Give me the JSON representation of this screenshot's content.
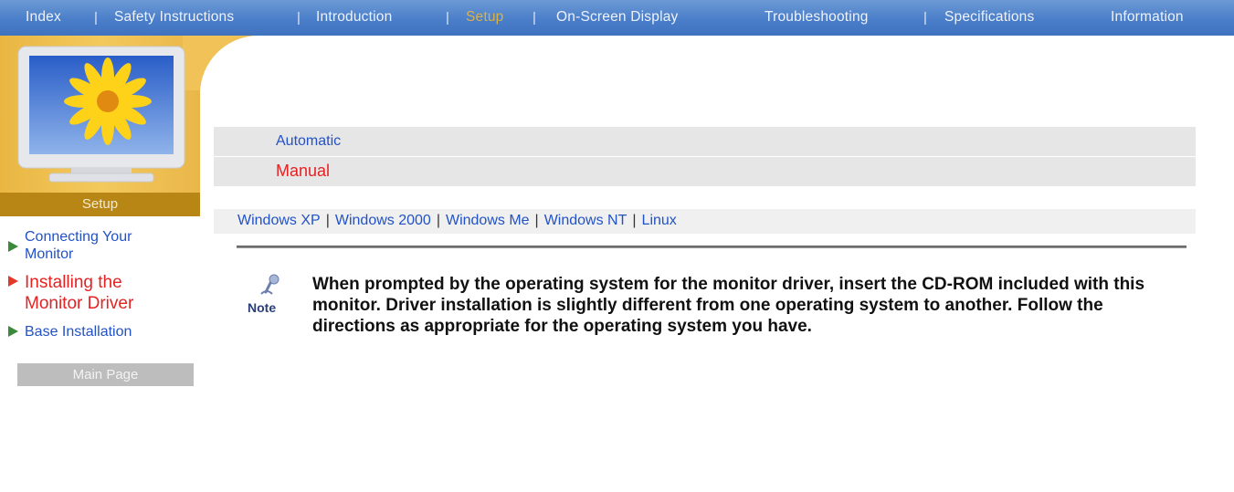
{
  "topnav": {
    "items": [
      {
        "label": "Index"
      },
      {
        "label": "Safety Instructions"
      },
      {
        "label": "Introduction"
      },
      {
        "label": "Setup",
        "active": true
      },
      {
        "label": "On-Screen Display"
      },
      {
        "label": "Troubleshooting"
      },
      {
        "label": "Specifications"
      },
      {
        "label": "Information"
      }
    ],
    "separator": "|"
  },
  "sidebar": {
    "section_title": "Setup",
    "items": [
      {
        "label": "Connecting Your Monitor"
      },
      {
        "label": "Installing the Monitor Driver",
        "current": true
      },
      {
        "label": "Base Installation"
      }
    ],
    "main_page_label": "Main Page"
  },
  "content": {
    "menu": [
      {
        "label": "Automatic"
      },
      {
        "label": "Manual",
        "current": true
      }
    ],
    "os_links": [
      "Windows XP",
      "Windows 2000",
      "Windows Me",
      "Windows NT",
      "Linux"
    ],
    "os_separator": "|",
    "note_label": "Note",
    "note_text": "When prompted by the operating system for the monitor driver, insert the CD-ROM included with this monitor. Driver installation is slightly different from one operating system to another. Follow the directions as appropriate for the operating system you have."
  },
  "colors": {
    "nav_blue": "#4a7ec9",
    "gold": "#efc056",
    "setup_bar": "#b88614",
    "link_blue": "#2252c6",
    "current_red": "#e52222"
  }
}
